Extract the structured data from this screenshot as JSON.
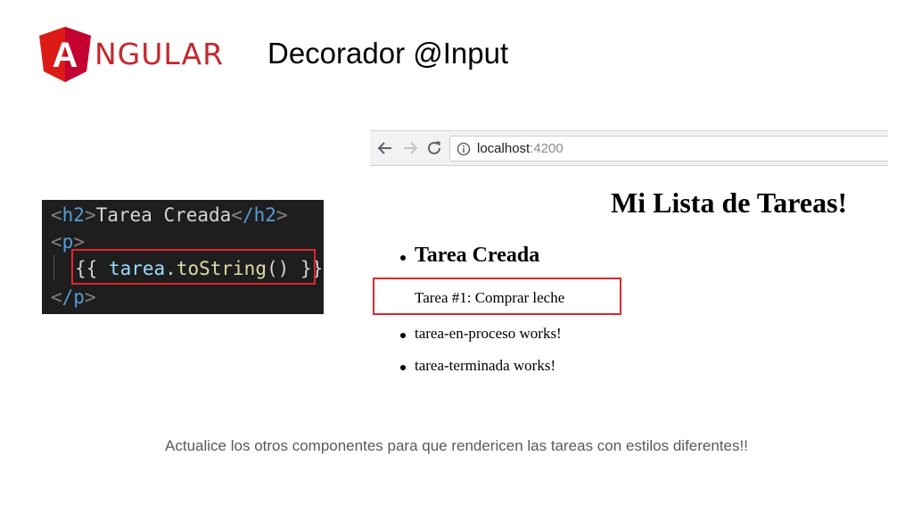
{
  "header": {
    "logo_text": "NGULAR",
    "logo_letter": "A",
    "title": "Decorador @Input"
  },
  "code": {
    "line1": {
      "open_tag": "h2",
      "text": "Tarea Creada",
      "close_tag": "/h2"
    },
    "line2": {
      "open_tag": "p"
    },
    "line3": {
      "open": "{{",
      "object": "tarea",
      "dot": ".",
      "method": "toString",
      "call": "()",
      "close": "}}"
    },
    "line4": {
      "close_tag": "/p"
    }
  },
  "browser": {
    "url_host": "localhost",
    "url_port": ":4200",
    "heading": "Mi Lista de Tareas!",
    "items": [
      {
        "title": "Tarea Creada",
        "detail": "Tarea #1: Comprar leche"
      },
      {
        "text": "tarea-en-proceso works!"
      },
      {
        "text": "tarea-terminada works!"
      }
    ]
  },
  "footer": {
    "note": "Actualice los otros componentes para que rendericen las tareas con estilos diferentes!!"
  },
  "colors": {
    "angular_red": "#c4282f",
    "highlight_red": "#e0262c",
    "code_bg": "#1e1e1e"
  },
  "icons": [
    "angular-logo-icon",
    "back-arrow-icon",
    "forward-arrow-icon",
    "reload-icon",
    "info-icon"
  ]
}
